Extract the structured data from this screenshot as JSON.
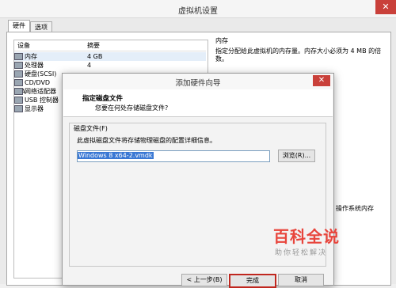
{
  "window": {
    "title": "虚拟机设置",
    "close": "✕"
  },
  "tabs": [
    "硬件",
    "选项"
  ],
  "device_list": {
    "col_device": "设备",
    "col_summary": "摘要",
    "rows": [
      {
        "name": "内存",
        "summary": "4 GB"
      },
      {
        "name": "处理器",
        "summary": "4"
      },
      {
        "name": "硬盘(SCSI)",
        "summary": ""
      },
      {
        "name": "CD/DVD (SA",
        "summary": ""
      },
      {
        "name": "网络适配器",
        "summary": ""
      },
      {
        "name": "USB 控制器",
        "summary": ""
      },
      {
        "name": "显示器",
        "summary": ""
      }
    ]
  },
  "memory_panel": {
    "title": "内存",
    "desc": "指定分配给此虚拟机的内存量。内存大小必须为 4 MB 的倍数。",
    "partial": "操作系统内存"
  },
  "dialog": {
    "title": "添加硬件向导",
    "close": "✕",
    "heading": "指定磁盘文件",
    "subheading": "您要在何处存储磁盘文件?",
    "group_label": "磁盘文件(F)",
    "group_desc": "此虚拟磁盘文件将存储物理磁盘的配置详细信息。",
    "file_value": "Windows 8 x64-2.vmdk",
    "browse": "浏览(R)...",
    "back": "< 上一步(B)",
    "finish": "完成",
    "cancel": "取消"
  },
  "watermark": {
    "main": "百科全说",
    "sub": "助你轻松解决"
  }
}
